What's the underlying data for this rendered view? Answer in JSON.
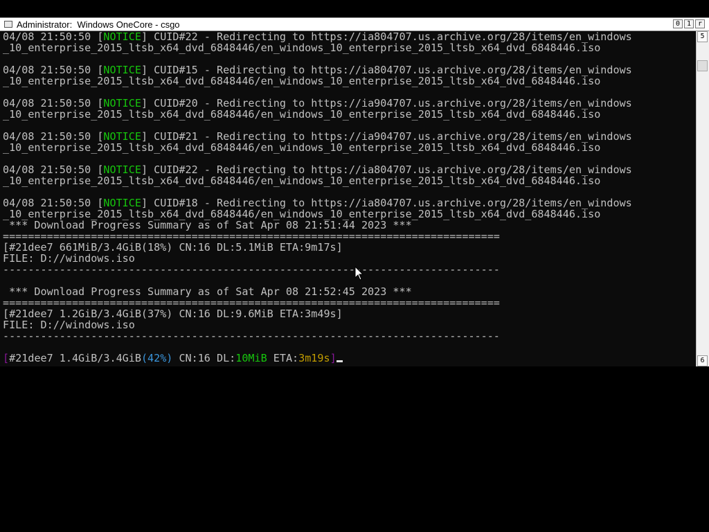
{
  "window": {
    "title": "Administrator:  Windows OneCore - csgo",
    "controls": [
      "0",
      "1",
      "r"
    ]
  },
  "scrollbar": {
    "up_glyph": "5",
    "down_glyph": "6"
  },
  "console": {
    "notice_tag": "NOTICE",
    "log": [
      {
        "ts": "04/08 21:50:50 ",
        "msg": " CUID#22 - Redirecting to https://ia804707.us.archive.org/28/items/en_windows",
        "cont": "_10_enterprise_2015_ltsb_x64_dvd_6848446/en_windows_10_enterprise_2015_ltsb_x64_dvd_6848446.iso"
      },
      {
        "ts": "04/08 21:50:50 ",
        "msg": " CUID#15 - Redirecting to https://ia804707.us.archive.org/28/items/en_windows",
        "cont": "_10_enterprise_2015_ltsb_x64_dvd_6848446/en_windows_10_enterprise_2015_ltsb_x64_dvd_6848446.iso"
      },
      {
        "ts": "04/08 21:50:50 ",
        "msg": " CUID#20 - Redirecting to https://ia904707.us.archive.org/28/items/en_windows",
        "cont": "_10_enterprise_2015_ltsb_x64_dvd_6848446/en_windows_10_enterprise_2015_ltsb_x64_dvd_6848446.iso"
      },
      {
        "ts": "04/08 21:50:50 ",
        "msg": " CUID#21 - Redirecting to https://ia904707.us.archive.org/28/items/en_windows",
        "cont": "_10_enterprise_2015_ltsb_x64_dvd_6848446/en_windows_10_enterprise_2015_ltsb_x64_dvd_6848446.iso"
      },
      {
        "ts": "04/08 21:50:50 ",
        "msg": " CUID#22 - Redirecting to https://ia804707.us.archive.org/28/items/en_windows",
        "cont": "_10_enterprise_2015_ltsb_x64_dvd_6848446/en_windows_10_enterprise_2015_ltsb_x64_dvd_6848446.iso"
      },
      {
        "ts": "04/08 21:50:50 ",
        "msg": " CUID#18 - Redirecting to https://ia804707.us.archive.org/28/items/en_windows",
        "cont": "_10_enterprise_2015_ltsb_x64_dvd_6848446/en_windows_10_enterprise_2015_ltsb_x64_dvd_6848446.iso"
      }
    ],
    "summaries": [
      {
        "header": " *** Download Progress Summary as of Sat Apr 08 21:51:44 2023 ***",
        "equals_rule": "===============================================================================",
        "progress": "[#21dee7 661MiB/3.4GiB(18%) CN:16 DL:5.1MiB ETA:9m17s]",
        "file": "FILE: D://windows.iso",
        "dash_rule": "-------------------------------------------------------------------------------"
      },
      {
        "header": " *** Download Progress Summary as of Sat Apr 08 21:52:45 2023 ***",
        "equals_rule": "===============================================================================",
        "progress": "[#21dee7 1.2GiB/3.4GiB(37%) CN:16 DL:9.6MiB ETA:3m49s]",
        "file": "FILE: D://windows.iso",
        "dash_rule": "-------------------------------------------------------------------------------"
      }
    ],
    "live": {
      "open_bracket": "[",
      "id_size": "#21dee7 1.4GiB/3.4GiB",
      "percent": "(42%)",
      "cn": " CN:16 DL:",
      "dl_speed": "10MiB",
      "eta_label": " ETA:",
      "eta": "3m19s",
      "close_bracket": "]"
    }
  },
  "colors": {
    "background": "#0c0c0c",
    "text": "#c0c0c0",
    "notice": "#16c60c",
    "percent": "#3a96dd",
    "eta": "#c19c00",
    "bracket": "#881798"
  }
}
